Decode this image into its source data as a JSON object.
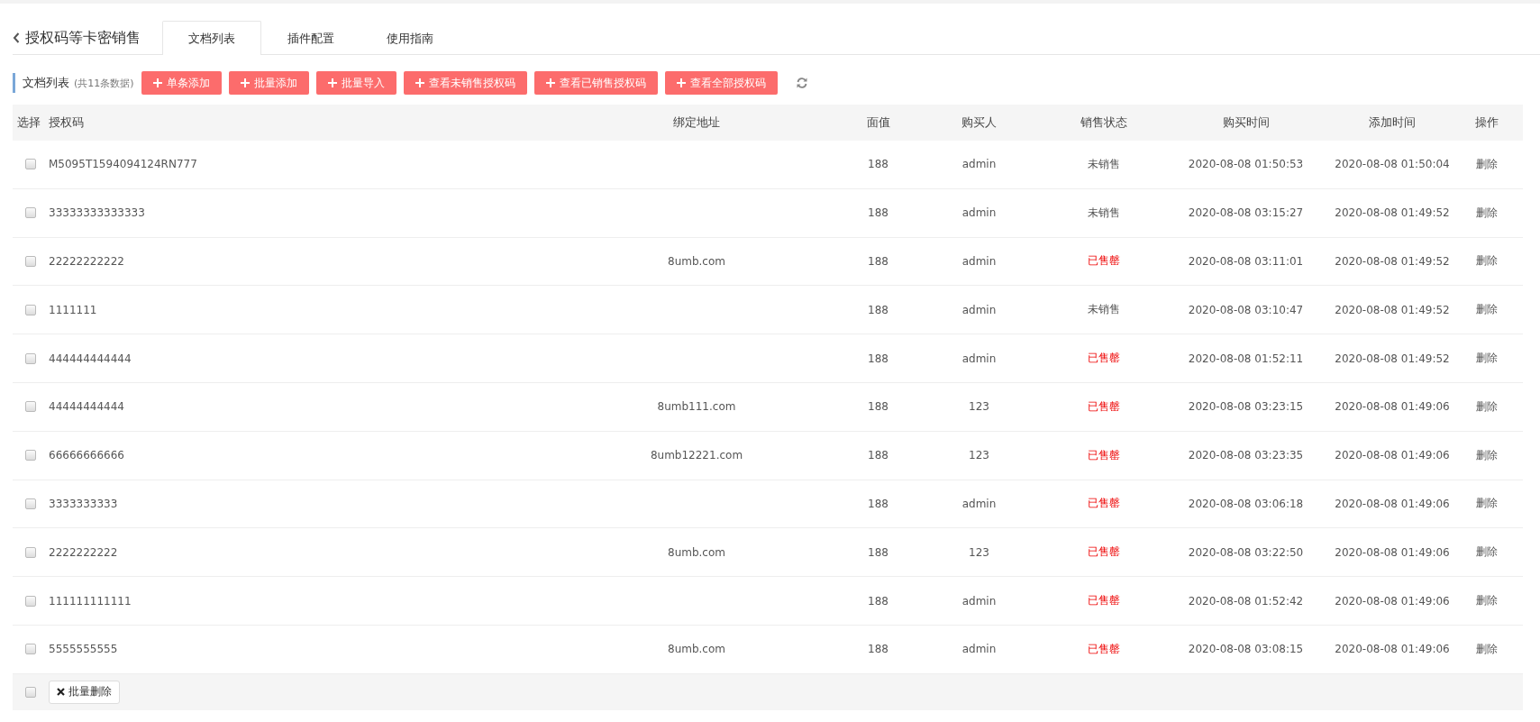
{
  "header": {
    "title": "授权码等卡密销售"
  },
  "tabs": [
    {
      "label": "文档列表",
      "selected": true
    },
    {
      "label": "插件配置",
      "selected": false
    },
    {
      "label": "使用指南",
      "selected": false
    }
  ],
  "toolbar": {
    "title": "文档列表",
    "count": "(共11条数据)",
    "buttons": [
      "单条添加",
      "批量添加",
      "批量导入",
      "查看未销售授权码",
      "查看已销售授权码",
      "查看全部授权码"
    ]
  },
  "table": {
    "columns": [
      "选择",
      "授权码",
      "绑定地址",
      "面值",
      "购买人",
      "销售状态",
      "购买时间",
      "添加时间",
      "操作"
    ],
    "rows": [
      {
        "checked": false,
        "code": "M5095T1594094124RN777",
        "address": "",
        "value": "188",
        "buyer": "admin",
        "status": "未销售",
        "sold": false,
        "buy_time": "2020-08-08 01:50:53",
        "add_time": "2020-08-08 01:50:04",
        "action": "删除"
      },
      {
        "checked": false,
        "code": "33333333333333",
        "address": "",
        "value": "188",
        "buyer": "admin",
        "status": "未销售",
        "sold": false,
        "buy_time": "2020-08-08 03:15:27",
        "add_time": "2020-08-08 01:49:52",
        "action": "删除"
      },
      {
        "checked": false,
        "code": "22222222222",
        "address": "8umb.com",
        "value": "188",
        "buyer": "admin",
        "status": "已售罄",
        "sold": true,
        "buy_time": "2020-08-08 03:11:01",
        "add_time": "2020-08-08 01:49:52",
        "action": "删除"
      },
      {
        "checked": false,
        "code": "1111111",
        "address": "",
        "value": "188",
        "buyer": "admin",
        "status": "未销售",
        "sold": false,
        "buy_time": "2020-08-08 03:10:47",
        "add_time": "2020-08-08 01:49:52",
        "action": "删除"
      },
      {
        "checked": false,
        "code": "444444444444",
        "address": "",
        "value": "188",
        "buyer": "admin",
        "status": "已售罄",
        "sold": true,
        "buy_time": "2020-08-08 01:52:11",
        "add_time": "2020-08-08 01:49:52",
        "action": "删除"
      },
      {
        "checked": false,
        "code": "44444444444",
        "address": "8umb111.com",
        "value": "188",
        "buyer": "123",
        "status": "已售罄",
        "sold": true,
        "buy_time": "2020-08-08 03:23:15",
        "add_time": "2020-08-08 01:49:06",
        "action": "删除"
      },
      {
        "checked": false,
        "code": "66666666666",
        "address": "8umb12221.com",
        "value": "188",
        "buyer": "123",
        "status": "已售罄",
        "sold": true,
        "buy_time": "2020-08-08 03:23:35",
        "add_time": "2020-08-08 01:49:06",
        "action": "删除"
      },
      {
        "checked": false,
        "code": "3333333333",
        "address": "",
        "value": "188",
        "buyer": "admin",
        "status": "已售罄",
        "sold": true,
        "buy_time": "2020-08-08 03:06:18",
        "add_time": "2020-08-08 01:49:06",
        "action": "删除"
      },
      {
        "checked": false,
        "code": "2222222222",
        "address": "8umb.com",
        "value": "188",
        "buyer": "123",
        "status": "已售罄",
        "sold": true,
        "buy_time": "2020-08-08 03:22:50",
        "add_time": "2020-08-08 01:49:06",
        "action": "删除"
      },
      {
        "checked": false,
        "code": "111111111111",
        "address": "",
        "value": "188",
        "buyer": "admin",
        "status": "已售罄",
        "sold": true,
        "buy_time": "2020-08-08 01:52:42",
        "add_time": "2020-08-08 01:49:06",
        "action": "删除"
      },
      {
        "checked": false,
        "code": "5555555555",
        "address": "8umb.com",
        "value": "188",
        "buyer": "admin",
        "status": "已售罄",
        "sold": true,
        "buy_time": "2020-08-08 03:08:15",
        "add_time": "2020-08-08 01:49:06",
        "action": "删除"
      }
    ],
    "footer": {
      "select_all_checked": false,
      "button": "批量删除"
    }
  }
}
